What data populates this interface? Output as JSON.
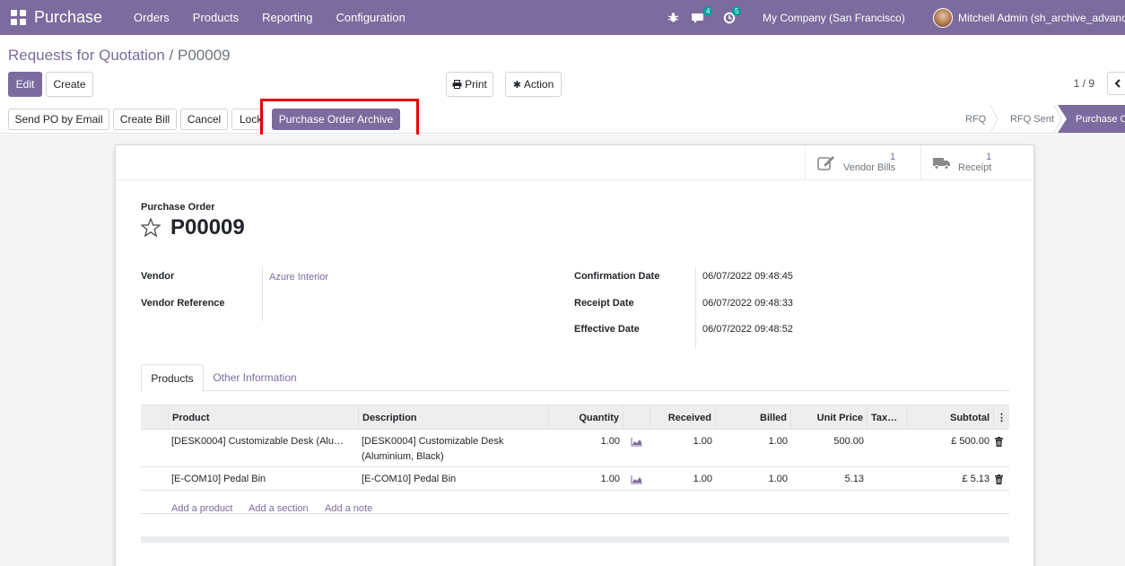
{
  "topbar": {
    "app_name": "Purchase",
    "menu": [
      "Orders",
      "Products",
      "Reporting",
      "Configuration"
    ],
    "chat_count": "4",
    "activity_count": "5",
    "company": "My Company (San Francisco)",
    "user": "Mitchell Admin (sh_archive_advance"
  },
  "breadcrumb": {
    "parent": "Requests for Quotation",
    "sep": " / ",
    "current": "P00009"
  },
  "toolbar": {
    "edit": "Edit",
    "create": "Create",
    "print": "Print",
    "action": "Action",
    "pager": "1 / 9"
  },
  "statusbar": {
    "buttons": [
      "Send PO by Email",
      "Create Bill",
      "Cancel",
      "Lock",
      "Purchase Order Archive"
    ],
    "stages": [
      "RFQ",
      "RFQ Sent",
      "Purchase O"
    ]
  },
  "smart_buttons": [
    {
      "count": "1",
      "label": "Vendor Bills",
      "icon": "pencil-square-icon"
    },
    {
      "count": "1",
      "label": "Receipt",
      "icon": "truck-icon"
    }
  ],
  "form": {
    "doc_type": "Purchase Order",
    "name": "P00009",
    "vendor_label": "Vendor",
    "vendor": "Azure Interior",
    "vendor_ref_label": "Vendor Reference",
    "confirmation_label": "Confirmation Date",
    "confirmation": "06/07/2022 09:48:45",
    "receipt_label": "Receipt Date",
    "receipt": "06/07/2022 09:48:33",
    "effective_label": "Effective Date",
    "effective": "06/07/2022 09:48:52"
  },
  "tabs": [
    "Products",
    "Other Information"
  ],
  "table": {
    "columns": [
      "Product",
      "Description",
      "Quantity",
      "",
      "Received",
      "Billed",
      "Unit Price",
      "Tax…",
      "Subtotal"
    ],
    "rows": [
      {
        "product": "[DESK0004] Customizable Desk (Alu…",
        "desc1": "[DESK0004] Customizable Desk",
        "desc2": "(Aluminium, Black)",
        "qty": "1.00",
        "received": "1.00",
        "billed": "1.00",
        "price": "500.00",
        "subtotal": "£ 500.00"
      },
      {
        "product": "[E-COM10] Pedal Bin",
        "desc1": "[E-COM10] Pedal Bin",
        "desc2": "",
        "qty": "1.00",
        "received": "1.00",
        "billed": "1.00",
        "price": "5.13",
        "subtotal": "£ 5.13"
      }
    ],
    "add_links": [
      "Add a product",
      "Add a section",
      "Add a note"
    ]
  },
  "colors": {
    "brand": "#7c6b9e",
    "highlight": "#e60000",
    "badge": "#00a09d"
  }
}
